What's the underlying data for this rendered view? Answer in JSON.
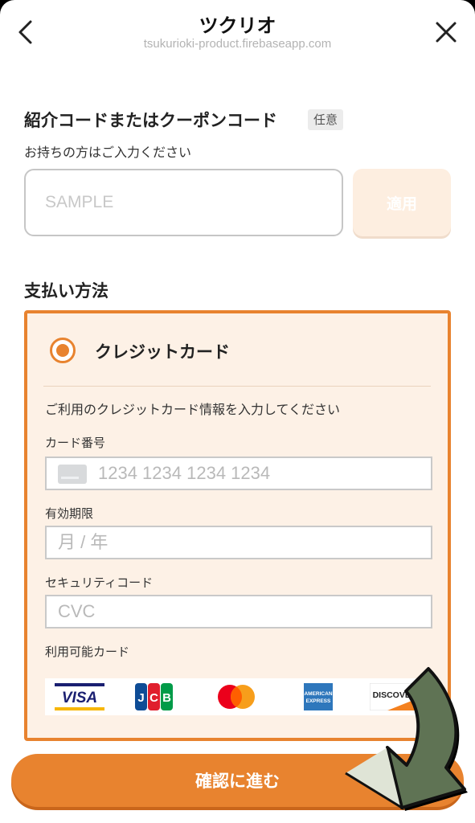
{
  "header": {
    "title": "ツクリオ",
    "url": "tsukurioki-product.firebaseapp.com"
  },
  "coupon": {
    "title": "紹介コードまたはクーポンコード",
    "optional_badge": "任意",
    "subtitle": "お持ちの方はご入力ください",
    "input_placeholder": "SAMPLE",
    "apply_label": "適用"
  },
  "payment": {
    "title": "支払い方法",
    "method_label": "クレジットカード",
    "instruction": "ご利用のクレジットカード情報を入力してください",
    "card_number_label": "カード番号",
    "card_number_placeholder": "1234 1234 1234 1234",
    "expiry_label": "有効期限",
    "expiry_placeholder": "月 / 年",
    "cvc_label": "セキュリティコード",
    "cvc_placeholder": "CVC",
    "brands_label": "利用可能カード",
    "brands": [
      "VISA",
      "JCB",
      "MASTERCARD",
      "AMERICAN EXPRESS",
      "DISCOVER"
    ]
  },
  "confirm_label": "確認に進む",
  "colors": {
    "accent": "#e8832f",
    "panel_bg": "#fdf1e6",
    "arrow_green": "#5f7354"
  }
}
